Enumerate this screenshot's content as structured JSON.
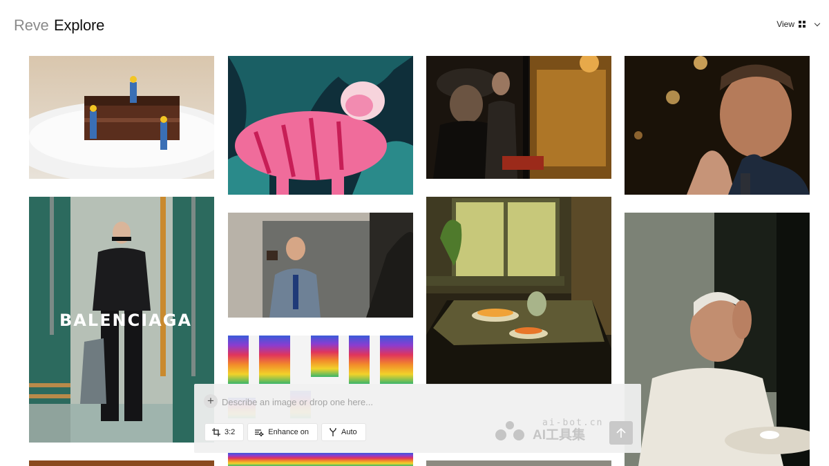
{
  "header": {
    "brand": "Reve",
    "title": "Explore",
    "view_label": "View"
  },
  "gallery": {
    "balenciaga_text": "BALENCIAGA",
    "tiles": [
      {
        "name": "cake-workers-image",
        "icon": "image"
      },
      {
        "name": "pink-tiger-image",
        "icon": "image"
      },
      {
        "name": "bar-window-men-image",
        "icon": "image"
      },
      {
        "name": "man-praying-hands-image",
        "icon": "image"
      },
      {
        "name": "balenciaga-model-image",
        "icon": "image"
      },
      {
        "name": "mirror-tie-man-image",
        "icon": "image"
      },
      {
        "name": "kitchen-table-window-image",
        "icon": "image"
      },
      {
        "name": "old-man-cafe-image",
        "icon": "image"
      },
      {
        "name": "rainbow-blocks-image",
        "icon": "image"
      }
    ]
  },
  "prompt": {
    "placeholder": "Describe an image or drop one here...",
    "aspect_label": "3:2",
    "enhance_label": "Enhance on",
    "auto_label": "Auto"
  },
  "watermark": {
    "top": "ai-bot.cn",
    "bottom": "AI工具集"
  },
  "colors": {
    "panel": "#f0f0f0",
    "send_button": "#c9c9c9",
    "tiger_pink": "#f06c9b",
    "foliage": "#17505e"
  }
}
